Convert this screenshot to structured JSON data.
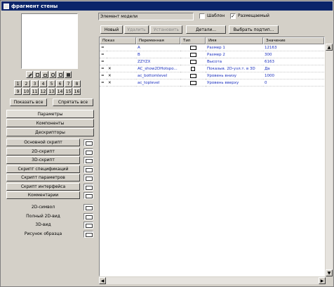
{
  "window": {
    "title": "фрагмент стены"
  },
  "left_panel": {
    "icon_toolbar": [
      "pencil-icon",
      "shape-icon",
      "sheet-icon",
      "layers-icon",
      "box-icon",
      "grid-icon"
    ],
    "number_buttons": [
      "1",
      "2",
      "3",
      "4",
      "5",
      "6",
      "7",
      "8",
      "9",
      "10",
      "11",
      "12",
      "13",
      "14",
      "15",
      "16"
    ],
    "show_all": "Показать все",
    "hide_all": "Спрятать все",
    "tabs": [
      "Параметры",
      "Компоненты",
      "Дескрипторы"
    ],
    "scripts": [
      "Основной скрипт",
      "2D-скрипт",
      "3D-скрипт",
      "Скрипт спецификаций",
      "Скрипт параметров",
      "Скрипт интерфейса",
      "Комментарии"
    ],
    "views": [
      "2D-символ",
      "Полный 2D-вид",
      "3D-вид",
      "Рисунок образца"
    ]
  },
  "top_controls": {
    "model_element_field": "Элемент модели",
    "template_label": "Шаблон",
    "template_checked": false,
    "placed_label": "Размещаемый",
    "placed_checked": true,
    "new_button": "Новый",
    "delete_button": "Удалить",
    "set_button": "Установить",
    "details_button": "Детали...",
    "choose_subtype_button": "Выбрать подтип..."
  },
  "table": {
    "headers": [
      "Показ",
      "Переменная",
      "Тип",
      "Имя",
      "Значение"
    ],
    "rows": [
      {
        "mark": "=",
        "show_icon": "",
        "variable": "A",
        "type_icon": "dimension-a-icon",
        "name": "Размер 1",
        "value": "12163"
      },
      {
        "mark": "=",
        "show_icon": "",
        "variable": "B",
        "type_icon": "dimension-b-icon",
        "name": "Размер 2",
        "value": "300"
      },
      {
        "mark": "=",
        "show_icon": "",
        "variable": "ZZYZX",
        "type_icon": "height-icon",
        "name": "Высота",
        "value": "6163"
      },
      {
        "mark": "=",
        "show_icon": "cross-icon",
        "variable": "AC_show2DHotspo...",
        "type_icon": "boolean-icon",
        "name": "Показыв. 2D-узл.т. в 3D",
        "value": "Да"
      },
      {
        "mark": "=",
        "show_icon": "cross-icon",
        "variable": "ac_bottomlevel",
        "type_icon": "length-icon",
        "name": "Уровень внизу",
        "value": "1000"
      },
      {
        "mark": "=",
        "show_icon": "cross-icon",
        "variable": "ac_toplevel",
        "type_icon": "length-icon",
        "name": "Уровень вверху",
        "value": "0"
      }
    ]
  }
}
